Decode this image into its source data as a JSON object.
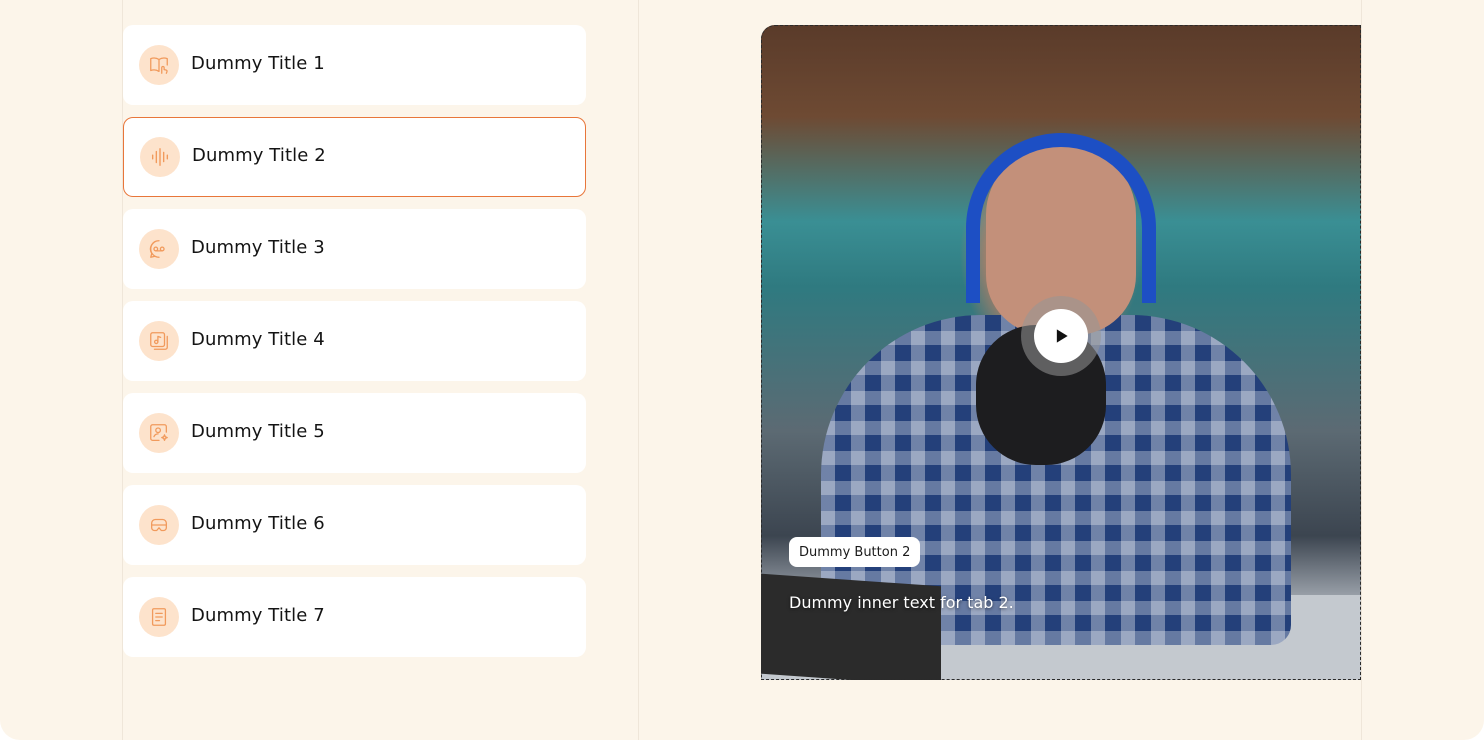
{
  "tabs": [
    {
      "label": "Dummy Title 1",
      "icon": "book-hand-icon",
      "active": false
    },
    {
      "label": "Dummy Title 2",
      "icon": "sound-wave-icon",
      "active": true
    },
    {
      "label": "Dummy Title 3",
      "icon": "voicemail-chat-icon",
      "active": false
    },
    {
      "label": "Dummy Title 4",
      "icon": "music-album-icon",
      "active": false
    },
    {
      "label": "Dummy Title 5",
      "icon": "profile-sparkle-icon",
      "active": false
    },
    {
      "label": "Dummy Title 6",
      "icon": "vr-headset-icon",
      "active": false
    },
    {
      "label": "Dummy Title 7",
      "icon": "document-icon",
      "active": false
    }
  ],
  "media": {
    "button_label": "Dummy Button 2",
    "inner_text": "Dummy inner text for tab 2.",
    "play_icon": "play-icon"
  },
  "colors": {
    "background": "#fcf5ea",
    "accent": "#e8763a",
    "icon_bg": "#fde3cc",
    "icon_stroke": "#f19a5c"
  }
}
